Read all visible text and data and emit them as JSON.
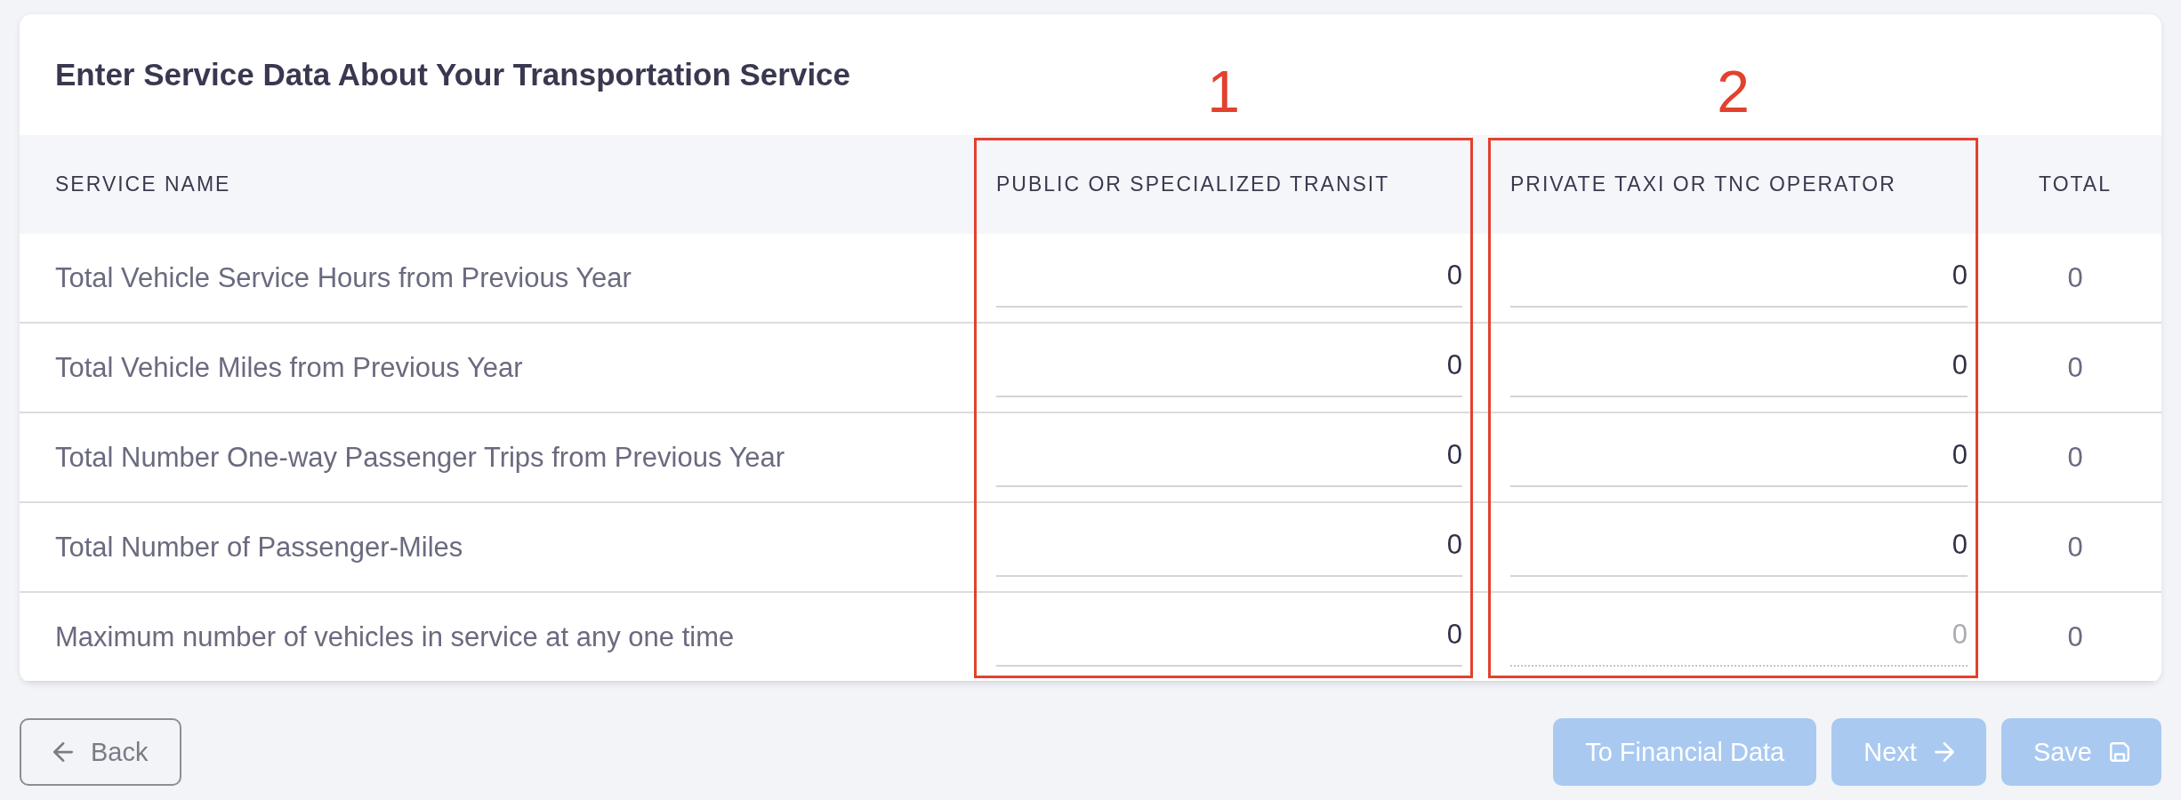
{
  "title": "Enter Service Data About Your Transportation Service",
  "table": {
    "columns": [
      {
        "label": "SERVICE NAME"
      },
      {
        "label": "PUBLIC OR SPECIALIZED TRANSIT",
        "annotation": "1"
      },
      {
        "label": "PRIVATE TAXI OR TNC OPERATOR",
        "annotation": "2"
      },
      {
        "label": "TOTAL"
      }
    ],
    "rows": [
      {
        "service_name": "Total Vehicle Service Hours from Previous Year",
        "inputs": [
          {
            "value": "0",
            "disabled": false
          },
          {
            "value": "0",
            "disabled": false
          }
        ],
        "total": "0"
      },
      {
        "service_name": "Total Vehicle Miles from Previous Year",
        "inputs": [
          {
            "value": "0",
            "disabled": false
          },
          {
            "value": "0",
            "disabled": false
          }
        ],
        "total": "0"
      },
      {
        "service_name": "Total Number One-way Passenger Trips from Previous Year",
        "inputs": [
          {
            "value": "0",
            "disabled": false
          },
          {
            "value": "0",
            "disabled": false
          }
        ],
        "total": "0"
      },
      {
        "service_name": "Total Number of Passenger-Miles",
        "inputs": [
          {
            "value": "0",
            "disabled": false
          },
          {
            "value": "0",
            "disabled": false
          }
        ],
        "total": "0"
      },
      {
        "service_name": "Maximum number of vehicles in service at any one time",
        "inputs": [
          {
            "value": "0",
            "disabled": false
          },
          {
            "value": "0",
            "disabled": true
          }
        ],
        "total": "0"
      }
    ]
  },
  "back_button": {
    "label": "Back"
  },
  "financial_data_button": {
    "label": "To Financial Data",
    "disabled": true
  },
  "next_button": {
    "label": "Next",
    "disabled": true
  },
  "save_button": {
    "label": "Save",
    "disabled": true
  }
}
